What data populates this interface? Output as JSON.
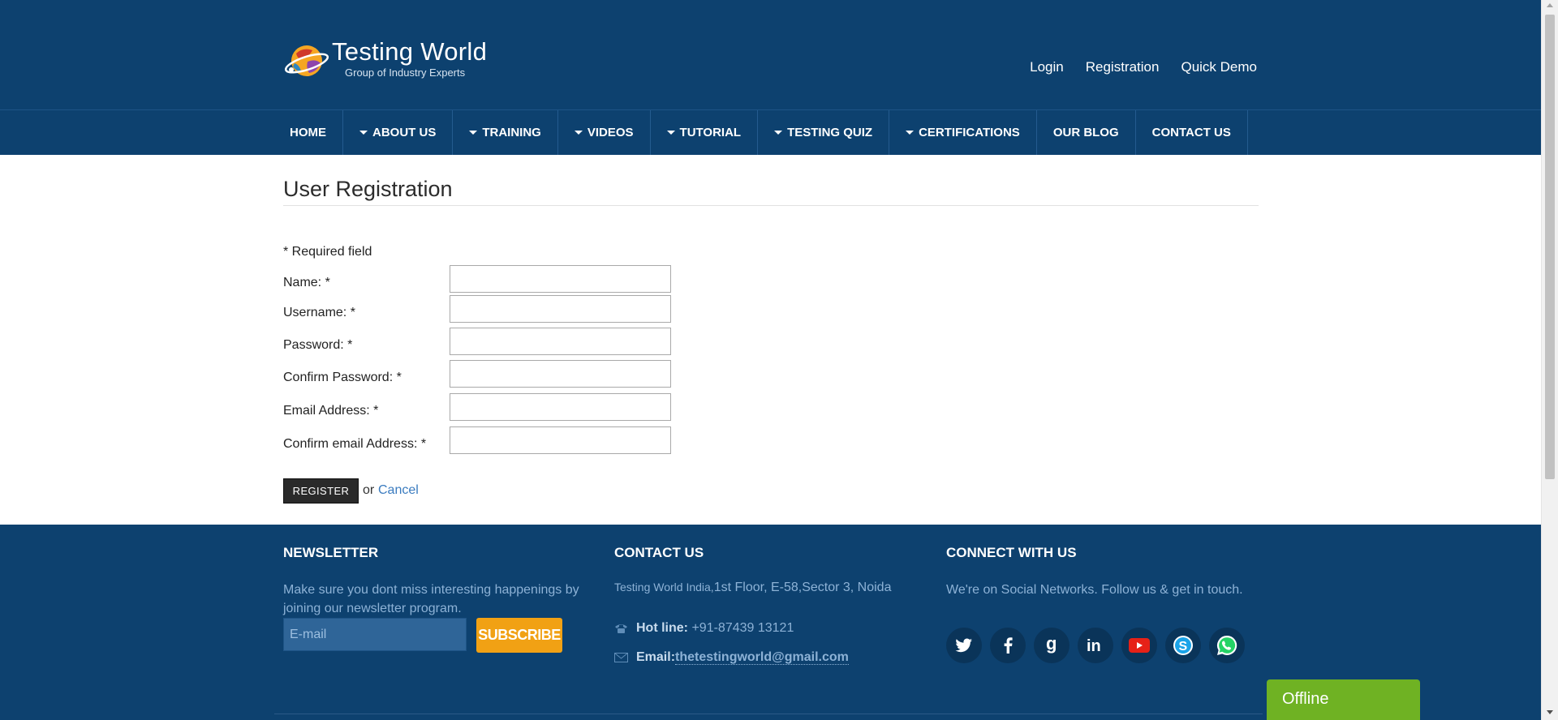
{
  "header": {
    "logo_title": "Testing World",
    "logo_subtitle": "Group of Industry Experts",
    "top_links": [
      "Login",
      "Registration",
      "Quick Demo"
    ]
  },
  "nav": [
    {
      "label": "HOME",
      "dropdown": false
    },
    {
      "label": "ABOUT US",
      "dropdown": true
    },
    {
      "label": "TRAINING",
      "dropdown": true
    },
    {
      "label": "VIDEOS",
      "dropdown": true
    },
    {
      "label": "TUTORIAL",
      "dropdown": true
    },
    {
      "label": "TESTING QUIZ",
      "dropdown": true
    },
    {
      "label": "CERTIFICATIONS",
      "dropdown": true
    },
    {
      "label": "OUR BLOG",
      "dropdown": false
    },
    {
      "label": "CONTACT US",
      "dropdown": false
    }
  ],
  "main": {
    "title": "User Registration",
    "required_note": "* Required field",
    "fields": [
      {
        "label": "Name: *",
        "value": ""
      },
      {
        "label": "Username: *",
        "value": ""
      },
      {
        "label": "Password: *",
        "value": ""
      },
      {
        "label": "Confirm Password: *",
        "value": ""
      },
      {
        "label": "Email Address: *",
        "value": ""
      },
      {
        "label": "Confirm email Address: *",
        "value": ""
      }
    ],
    "register_label": "REGISTER",
    "or_text": "or",
    "cancel_label": "Cancel"
  },
  "footer": {
    "newsletter": {
      "heading": "NEWSLETTER",
      "text": "Make sure you dont miss interesting happenings by joining our newsletter program.",
      "email_placeholder": "E-mail",
      "subscribe_label": "SUBSCRIBE"
    },
    "contact": {
      "heading": "CONTACT US",
      "address_prefix": "Testing World India,",
      "address_rest": "1st Floor, E-58,Sector 3, Noida",
      "hotline_label": "Hot line:",
      "hotline_value": "+91-87439 13121",
      "email_label": "Email:",
      "email_value": "thetestingworld@gmail.com"
    },
    "connect": {
      "heading": "CONNECT WITH US",
      "text": "We're on Social Networks. Follow us & get in touch.",
      "icons": [
        "twitter-icon",
        "facebook-icon",
        "google-icon",
        "linkedin-icon",
        "youtube-icon",
        "skype-icon",
        "whatsapp-icon"
      ]
    }
  },
  "chat": {
    "status": "Offline"
  },
  "colors": {
    "header_bg": "#0d416f",
    "accent_orange": "#f1a114",
    "chat_green": "#6fb223",
    "link_blue": "#3a7bbf"
  }
}
